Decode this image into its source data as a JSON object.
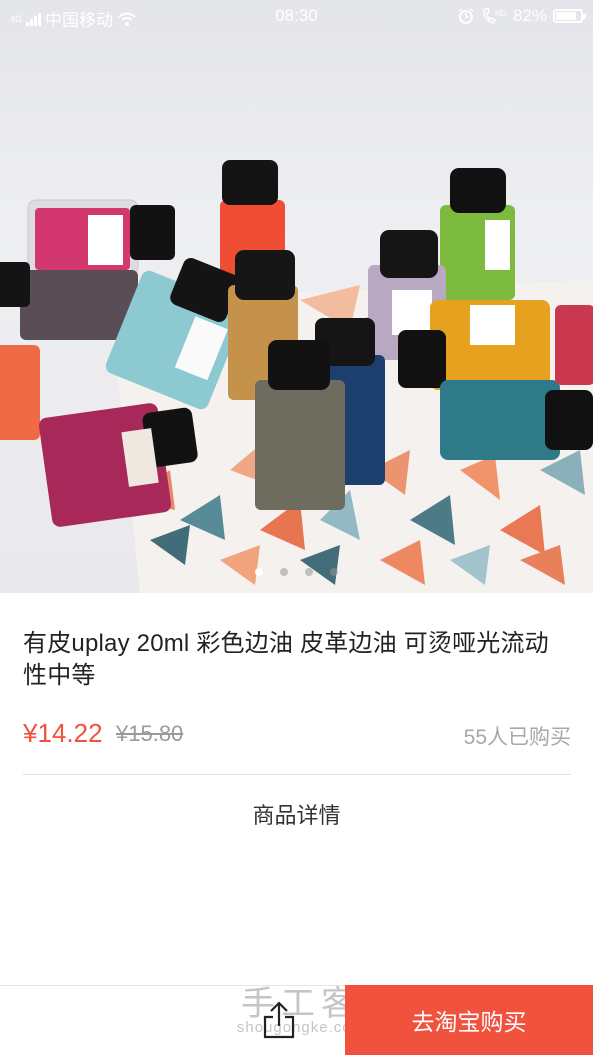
{
  "status_bar": {
    "network_type": "4G",
    "carrier": "中国移动",
    "time": "08:30",
    "battery_percent": "82%",
    "battery_level": 0.82,
    "icons": [
      "signal-icon",
      "wifi-icon",
      "alarm-icon",
      "volte-call-icon",
      "battery-icon"
    ]
  },
  "hero": {
    "image_icon": "product-photo",
    "carousel_total": 4,
    "carousel_active": 1
  },
  "product": {
    "title": "有皮uplay 20ml 彩色边油 皮革边油 可烫哑光流动性中等",
    "price": "¥14.22",
    "original_price": "¥15.80",
    "sold_count": "55人已购买"
  },
  "detail": {
    "heading": "商品详情"
  },
  "bottom_bar": {
    "share_icon": "share-icon",
    "buy_label": "去淘宝购买",
    "accent_color": "#f0523e"
  },
  "watermark": {
    "cn": "手工客",
    "en": "shougongke.com"
  }
}
